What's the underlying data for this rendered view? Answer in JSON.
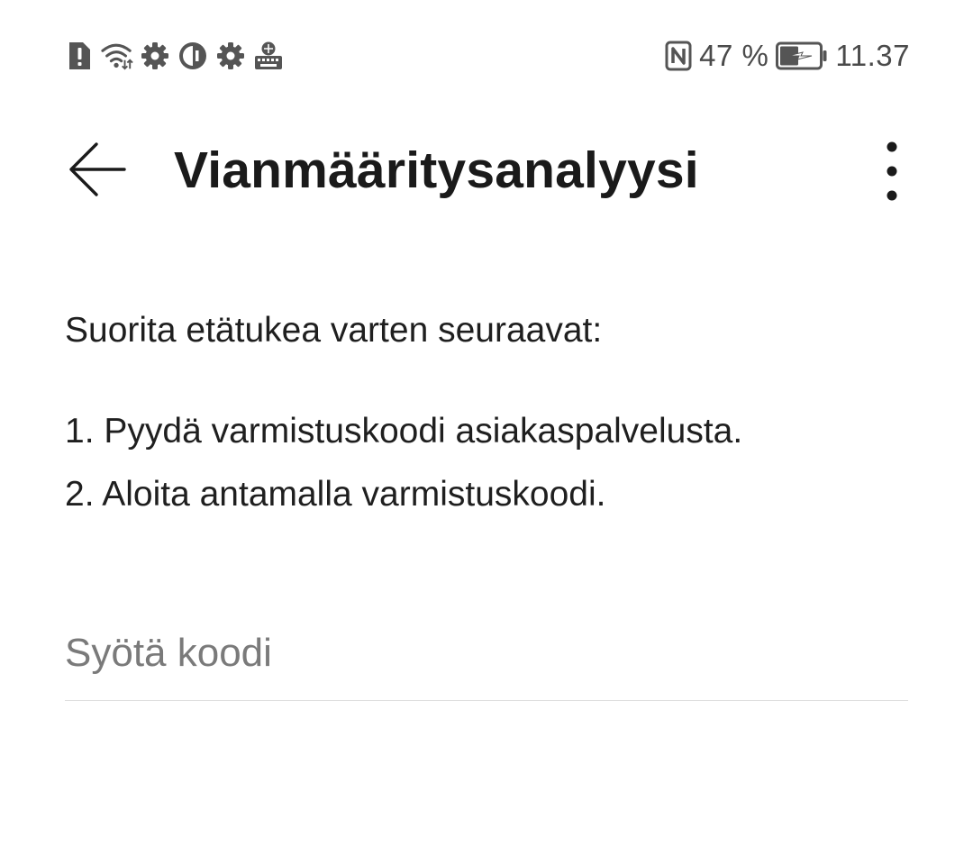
{
  "status_bar": {
    "left_icons": [
      "alert-icon",
      "wifi-icon",
      "settings-icon",
      "vpn-icon",
      "settings-icon",
      "keyboard-icon"
    ],
    "nfc_icon": "nfc-icon",
    "battery_percent": "47 %",
    "battery_level": 0.47,
    "charging": true,
    "time": "11.37"
  },
  "app_bar": {
    "back_icon": "arrow-left-icon",
    "title": "Vianmääritysanalyysi",
    "more_icon": "more-vertical-icon"
  },
  "content": {
    "intro": "Suorita etätukea varten seuraavat:",
    "steps": [
      "1. Pyydä varmistuskoodi asiakaspalvelusta.",
      "2. Aloita antamalla varmistuskoodi."
    ]
  },
  "code_input": {
    "value": "",
    "placeholder": "Syötä koodi"
  },
  "colors": {
    "background": "#ffffff",
    "text": "#1a1a1a",
    "status_text": "#4a4a4a",
    "placeholder": "#7a7a7a",
    "divider": "#dcdcdc"
  }
}
